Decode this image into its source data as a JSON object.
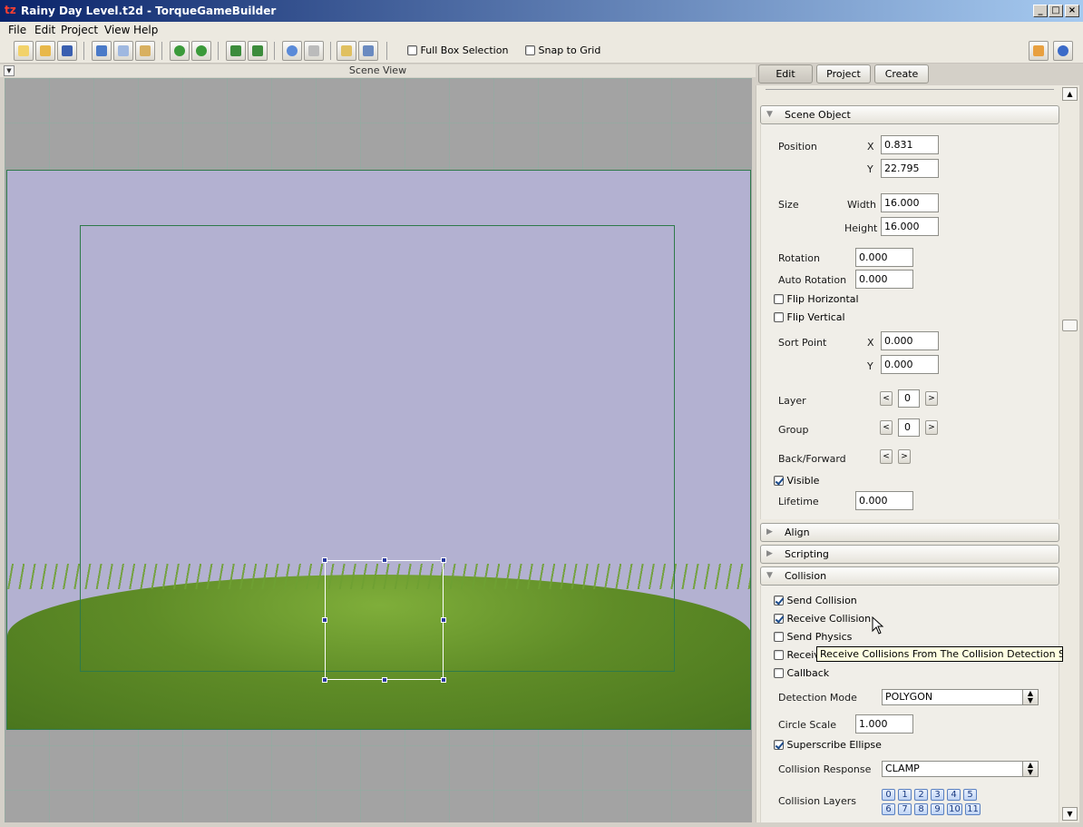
{
  "window": {
    "title": "Rainy Day Level.t2d - TorqueGameBuilder",
    "app_icon": "torque-logo-icon"
  },
  "menu": [
    "File",
    "Edit",
    "Project",
    "View",
    "Help"
  ],
  "toolbar": {
    "full_box_selection": {
      "label": "Full Box Selection",
      "checked": false
    },
    "snap_to_grid": {
      "label": "Snap to Grid",
      "checked": false
    }
  },
  "scene": {
    "header": "Scene View"
  },
  "tabs": [
    "Edit",
    "Project",
    "Create"
  ],
  "inspector": {
    "scene_object": {
      "title": "Scene Object",
      "position_label": "Position",
      "x_label": "X",
      "y_label": "Y",
      "position_x": "0.831",
      "position_y": "22.795",
      "size_label": "Size",
      "width_label": "Width",
      "height_label": "Height",
      "width": "16.000",
      "height": "16.000",
      "rotation_label": "Rotation",
      "rotation": "0.000",
      "auto_rotation_label": "Auto Rotation",
      "auto_rotation": "0.000",
      "flip_horizontal": {
        "label": "Flip Horizontal",
        "checked": false
      },
      "flip_vertical": {
        "label": "Flip Vertical",
        "checked": false
      },
      "sort_point_label": "Sort Point",
      "sort_x": "0.000",
      "sort_y": "0.000",
      "layer_label": "Layer",
      "layer": "0",
      "group_label": "Group",
      "group": "0",
      "back_forward_label": "Back/Forward",
      "dec": "<",
      "inc": ">",
      "visible": {
        "label": "Visible",
        "checked": true
      },
      "lifetime_label": "Lifetime",
      "lifetime": "0.000"
    },
    "align": {
      "title": "Align"
    },
    "scripting": {
      "title": "Scripting"
    },
    "collision": {
      "title": "Collision",
      "send_collision": {
        "label": "Send Collision",
        "checked": true
      },
      "receive_collision": {
        "label": "Receive Collision",
        "checked": true
      },
      "send_physics": {
        "label": "Send Physics",
        "checked": false
      },
      "receive_physics": {
        "label": "Receiv",
        "checked": false
      },
      "callback": {
        "label": "Callback",
        "checked": false
      },
      "detection_mode_label": "Detection Mode",
      "detection_mode": "POLYGON",
      "circle_scale_label": "Circle Scale",
      "circle_scale": "1.000",
      "superscribe_ellipse": {
        "label": "Superscribe Ellipse",
        "checked": true
      },
      "collision_response_label": "Collision Response",
      "collision_response": "CLAMP",
      "collision_layers_label": "Collision Layers",
      "layers_row1": [
        "0",
        "1",
        "2",
        "3",
        "4",
        "5"
      ],
      "layers_row2": [
        "6",
        "7",
        "8",
        "9",
        "10",
        "11"
      ]
    }
  },
  "tooltip": "Receive Collisions From The Collision Detection System."
}
